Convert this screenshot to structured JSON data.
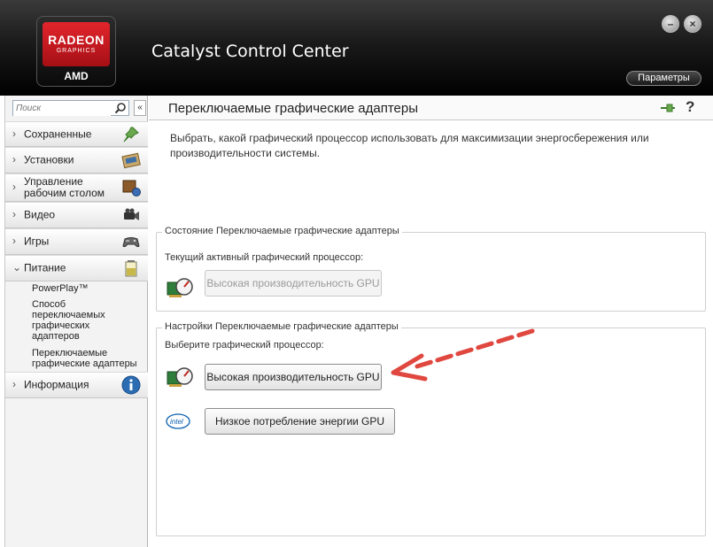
{
  "header": {
    "logo_brand": "RADEON",
    "logo_sub": "GRAPHICS",
    "logo_vendor": "AMD",
    "app_title": "Catalyst Control Center",
    "minimize_label": "–",
    "close_label": "×",
    "params_button": "Параметры"
  },
  "sidebar": {
    "search_placeholder": "Поиск",
    "collapse_label": "«",
    "items": [
      {
        "label": "Сохраненные",
        "icon": "pin-icon"
      },
      {
        "label": "Установки",
        "icon": "settings-icon"
      },
      {
        "label": "Управление рабочим столом",
        "icon": "desktop-icon"
      },
      {
        "label": "Видео",
        "icon": "camera-icon"
      },
      {
        "label": "Игры",
        "icon": "gamepad-icon"
      },
      {
        "label": "Питание",
        "icon": "battery-icon",
        "expanded": true
      },
      {
        "label": "Информация",
        "icon": "info-icon"
      }
    ],
    "subitems": [
      "PowerPlay™",
      "Способ переключаемых графических адаптеров",
      "Переключаемые графические адаптеры"
    ]
  },
  "main": {
    "title": "Переключаемые графические адаптеры",
    "description": "Выбрать, какой графический процессор использовать для максимизации энергосбережения или производительности системы.",
    "status_group": {
      "legend": "Состояние Переключаемые графические адаптеры",
      "label": "Текущий активный графический процессор:",
      "value": "Высокая производительность GPU"
    },
    "settings_group": {
      "legend": "Настройки Переключаемые графические адаптеры",
      "label": "Выберите графический процессор:",
      "high_perf_button": "Высокая производительность GPU",
      "low_power_button": "Низкое потребление энергии GPU",
      "intel_logo": "intel"
    }
  },
  "colors": {
    "header_bg": "#1a1a1a",
    "logo_red": "#d71920",
    "arrow_red": "#e0473f",
    "info_blue": "#2b6cb3"
  }
}
